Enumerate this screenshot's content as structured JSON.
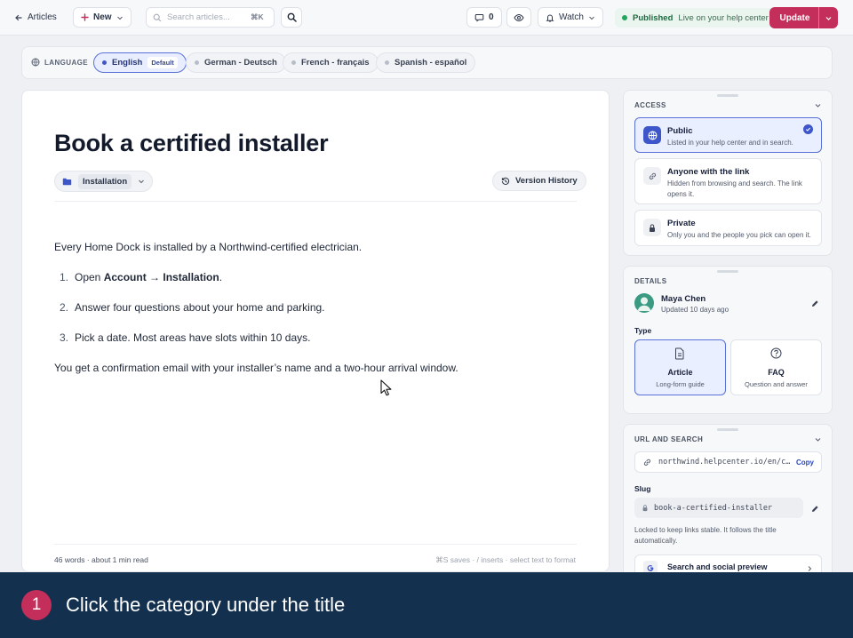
{
  "topbar": {
    "back_label": "Articles",
    "new_label": "New",
    "search_placeholder": "Search articles...",
    "search_shortcut": "⌘K",
    "comments_count": "0",
    "watch_label": "Watch",
    "status_label": "Published",
    "status_sub": "Live on your help center",
    "update_label": "Update",
    "status_color": "#24a55d",
    "accent_color": "#c42e5a"
  },
  "language": {
    "label": "LANGUAGE",
    "items": [
      {
        "name": "English",
        "badge": "Default",
        "active": true
      },
      {
        "name": "German - Deutsch"
      },
      {
        "name": "French - français"
      },
      {
        "name": "Spanish - español"
      }
    ]
  },
  "editor": {
    "title": "Book a certified installer",
    "category": "Installation",
    "version_history": "Version History",
    "intro": "Every Home Dock is installed by a Northwind-certified electrician.",
    "steps": [
      {
        "num": "1.",
        "pre": "Open ",
        "bold": "Account → Installation",
        "post": "."
      },
      {
        "num": "2.",
        "text": "Answer four questions about your home and parking."
      },
      {
        "num": "3.",
        "text": "Pick a date. Most areas have slots within 10 days."
      }
    ],
    "outro": "You get a confirmation email with your installer’s name and a two-hour arrival window.",
    "word_count": "46 words · about 1 min read",
    "hint": "⌘S saves · / inserts · select text to format"
  },
  "access": {
    "label": "ACCESS",
    "options": [
      {
        "title": "Public",
        "desc": "Listed in your help center and in search.",
        "icon": "globe-icon",
        "selected": true
      },
      {
        "title": "Anyone with the link",
        "desc": "Hidden from browsing and search. The link opens it.",
        "icon": "link-icon"
      },
      {
        "title": "Private",
        "desc": "Only you and the people you pick can open it.",
        "icon": "lock-icon"
      }
    ]
  },
  "details": {
    "label": "DETAILS",
    "author": "Maya Chen",
    "updated": "Updated 10 days ago",
    "type_label": "Type",
    "types": [
      {
        "title": "Article",
        "desc": "Long-form guide",
        "icon": "document-icon",
        "selected": true
      },
      {
        "title": "FAQ",
        "desc": "Question and answer",
        "icon": "question-icon"
      }
    ]
  },
  "url": {
    "label": "URL AND SEARCH",
    "url": "northwind.helpcenter.io/en/c…",
    "copy": "Copy",
    "slug_label": "Slug",
    "slug": "book-a-certified-installer",
    "note": "Locked to keep links stable. It follows the title automatically.",
    "preview_label": "Search and social preview"
  },
  "tutorial": {
    "step": "1",
    "instruction": "Click the category under the title"
  }
}
